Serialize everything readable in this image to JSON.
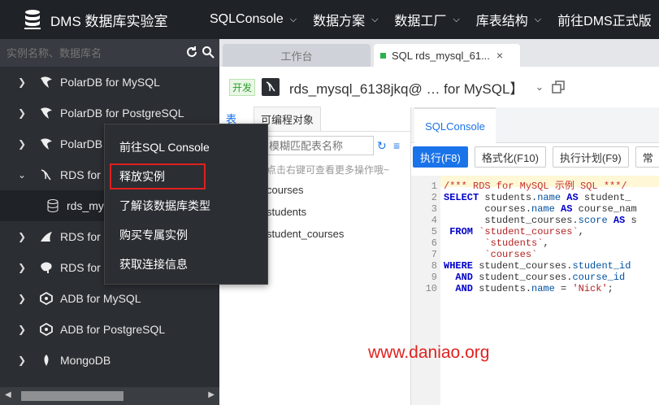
{
  "app": {
    "title": "DMS 数据库实验室"
  },
  "topnav": [
    {
      "label": "SQLConsole"
    },
    {
      "label": "数据方案"
    },
    {
      "label": "数据工厂"
    },
    {
      "label": "库表结构"
    },
    {
      "label": "前往DMS正式版"
    }
  ],
  "sidebar": {
    "search_placeholder": "实例名称、数据库名",
    "items": [
      {
        "label": "PolarDB for MySQL",
        "icon": "polardb-icon",
        "expanded": false
      },
      {
        "label": "PolarDB for PostgreSQL",
        "icon": "polardb-icon",
        "expanded": false
      },
      {
        "label": "PolarDB fo",
        "icon": "polardb-icon",
        "expanded": false
      },
      {
        "label": "RDS for M",
        "icon": "mysql-dolphin-icon",
        "expanded": true
      },
      {
        "label": "rds_mys",
        "icon": "database-icon",
        "child": true
      },
      {
        "label": "RDS for S",
        "icon": "sqlserver-icon",
        "expanded": false
      },
      {
        "label": "RDS for Po",
        "icon": "postgresql-elephant-icon",
        "expanded": false
      },
      {
        "label": "ADB for MySQL",
        "icon": "adb-icon",
        "expanded": false
      },
      {
        "label": "ADB for PostgreSQL",
        "icon": "adb-icon",
        "expanded": false
      },
      {
        "label": "MongoDB",
        "icon": "mongodb-leaf-icon",
        "expanded": false
      }
    ]
  },
  "context_menu": {
    "items": [
      {
        "label": "前往SQL Console"
      },
      {
        "label": "释放实例",
        "highlighted": true
      },
      {
        "label": "了解该数据库类型"
      },
      {
        "label": "购买专属实例"
      },
      {
        "label": "获取连接信息"
      }
    ]
  },
  "tabs": [
    {
      "label": "工作台",
      "active": false
    },
    {
      "label": "SQL rds_mysql_61...",
      "active": true,
      "close": "×"
    }
  ],
  "instance": {
    "env": "开发",
    "name": "rds_mysql_6138jkq@ … for MySQL】"
  },
  "left_panel": {
    "tabs": [
      "表",
      "可编程对象"
    ],
    "search_placeholder": "模糊匹配表名称",
    "hint": "点击右键可查看更多操作哦~",
    "tables": [
      "courses",
      "students",
      "student_courses"
    ]
  },
  "editor": {
    "tab": "SQLConsole",
    "toolbar": [
      {
        "label": "执行(F8)",
        "primary": true
      },
      {
        "label": "格式化(F10)",
        "primary": false
      },
      {
        "label": "执行计划(F9)",
        "primary": false
      },
      {
        "label": "常",
        "primary": false
      }
    ],
    "lines": [
      {
        "n": "1",
        "text": "/*** RDS for MySQL 示例 SQL ***/"
      },
      {
        "n": "2",
        "text": "SELECT students.name AS student_"
      },
      {
        "n": "3",
        "text": "       courses.name AS course_nam"
      },
      {
        "n": "4",
        "text": "       student_courses.score AS s"
      },
      {
        "n": "5",
        "text": " FROM `student_courses`,"
      },
      {
        "n": "6",
        "text": "       `students`,"
      },
      {
        "n": "7",
        "text": "       `courses`"
      },
      {
        "n": "8",
        "text": "WHERE student_courses.student_id"
      },
      {
        "n": "9",
        "text": "  AND student_courses.course_id "
      },
      {
        "n": "10",
        "text": "  AND students.name = 'Nick';"
      }
    ]
  },
  "watermark": "www.daniao.org",
  "colors": {
    "topbar": "#1f2227",
    "sidebar": "#2b2e33",
    "accent": "#1a73e8",
    "menu_highlight": "#e01f1f",
    "env_green": "#2e9e2e"
  }
}
